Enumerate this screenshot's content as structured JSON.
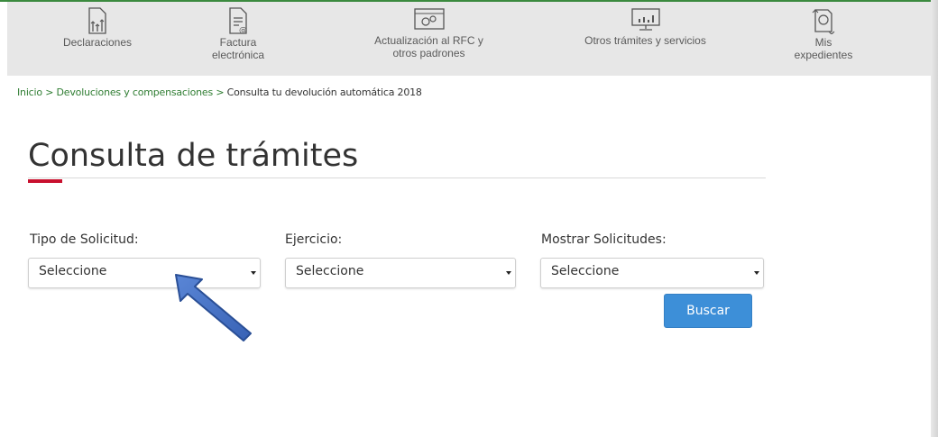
{
  "nav": {
    "items": [
      {
        "label": "Declaraciones"
      },
      {
        "label": "Factura\nelectrónica"
      },
      {
        "label": "Actualización al RFC y\notros padrones"
      },
      {
        "label": "Otros trámites y servicios"
      },
      {
        "label": "Mis\nexpedientes"
      }
    ]
  },
  "breadcrumb": {
    "home": "Inicio",
    "sep": ">",
    "section": "Devoluciones y compensaciones",
    "current": "Consulta tu devolución automática 2018"
  },
  "page": {
    "title": "Consulta de trámites"
  },
  "form": {
    "tipo": {
      "label": "Tipo de Solicitud:",
      "value": "Seleccione"
    },
    "ejercicio": {
      "label": "Ejercicio:",
      "value": "Seleccione"
    },
    "mostrar": {
      "label": "Mostrar Solicitudes:",
      "value": "Seleccione"
    },
    "submit": "Buscar"
  },
  "colors": {
    "accent_green": "#2f7d32",
    "title_accent_red": "#c8102e",
    "button_blue": "#3d8fd8",
    "annotation_arrow": "#3e6ec4"
  }
}
